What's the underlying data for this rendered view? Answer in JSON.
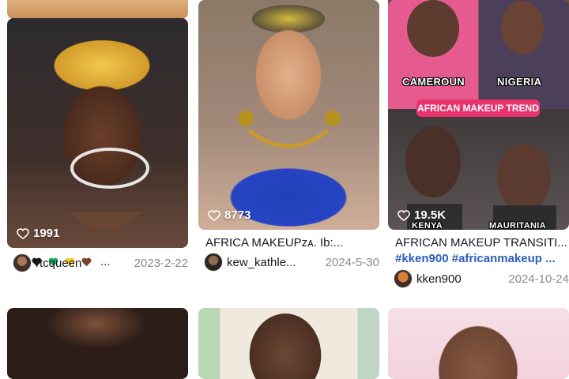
{
  "grid": {
    "cards": [
      {
        "likes": "1991",
        "caption_emojis": [
          "red-heart",
          "black-heart",
          "green-heart",
          "yellow-heart",
          "brown-heart"
        ],
        "caption_suffix": "...",
        "username": "rtcqueen",
        "date": "2023-2-22"
      },
      {
        "likes": "8773",
        "caption": "AFRICA MAKEUPᴢᴀ. Ib:...",
        "username": "kew_kathle...",
        "date": "2024-5-30"
      },
      {
        "likes": "19.5K",
        "caption": "AFRICAN MAKEUP TRANSITI...",
        "hashtags": "#kken900 #africanmakeup ...",
        "username": "kken900",
        "date": "2024-10-24",
        "overlay_labels": {
          "left_country": "CAMEROUN",
          "right_country": "NIGERIA",
          "trend": "AFRICAN MAKEUP TREND",
          "bottom_left": "KENYA",
          "bottom_right": "MAURITANIA"
        }
      }
    ]
  },
  "colors": {
    "hashtag": "#2b5db9",
    "date": "#8a8b91",
    "text": "#161823",
    "trend_pill": "#e8336d"
  },
  "icons": {
    "likes": "heart-outline-icon"
  }
}
